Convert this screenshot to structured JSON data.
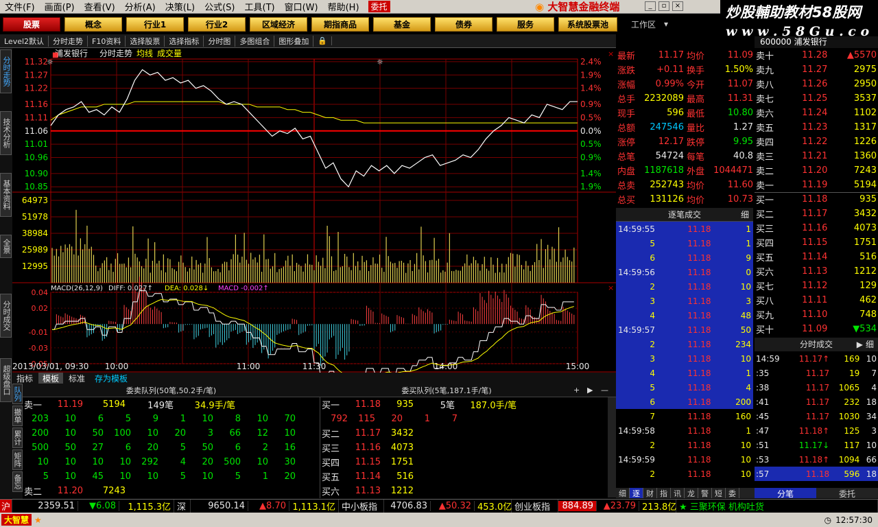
{
  "menu": {
    "items": [
      "文件(F)",
      "画面(P)",
      "查看(V)",
      "分析(A)",
      "决策(L)",
      "公式(S)",
      "工具(T)",
      "窗口(W)",
      "帮助(H)"
    ],
    "entrust": "委托",
    "brand": "大智慧金融终端"
  },
  "logo": {
    "line1": "炒股輔助教材58股网",
    "line2": "w w w . 5 8 G u . c o m"
  },
  "categories": [
    "股票",
    "概念",
    "行业1",
    "行业2",
    "区域经济",
    "期指商品",
    "基金",
    "债券",
    "服务",
    "系统股票池"
  ],
  "workarea": "工作区",
  "toolbar": [
    "Level2默认",
    "分时走势",
    "F10资料",
    "选择股票",
    "选择指标",
    "分时图",
    "多图组合",
    "图形叠加"
  ],
  "side_tabs": [
    "分时走势",
    "技术分析",
    "基本资料",
    "全景",
    "分时成交",
    "超级盘口"
  ],
  "chart": {
    "stock_name": "浦发银行",
    "view": "分时走势",
    "avg_label": "均线",
    "vol_label": "成交量",
    "price_ticks": [
      "11.32",
      "11.27",
      "11.22",
      "11.16",
      "11.11",
      "11.06",
      "11.01",
      "10.96",
      "10.90",
      "10.85"
    ],
    "pct_ticks": [
      "2.4%",
      "1.9%",
      "1.4%",
      "0.9%",
      "0.5%",
      "0.0%",
      "0.5%",
      "0.9%",
      "1.4%",
      "1.9%"
    ],
    "vol_ticks": [
      "64973",
      "51978",
      "38984",
      "25989",
      "12995"
    ],
    "macd_label": "MACD(26,12,9)",
    "diff_label": "DIFF: 0.027↑",
    "dea_label": "DEA: 0.028↓",
    "macd_val_label": "MACD -0.002↑",
    "macd_ticks": [
      "0.04",
      "0.02",
      "-0.01",
      "-0.03",
      "-0.05"
    ],
    "time_ticks": [
      "2013/03/01, 09:30",
      "10:00",
      "11:00",
      "11:30",
      "14:00",
      "15:00"
    ]
  },
  "chart_data": {
    "type": "line",
    "title": "",
    "prev_close": 11.06,
    "ylim": [
      10.83,
      11.33
    ],
    "series": [
      {
        "name": "",
        "values": [
          11.08,
          11.12,
          11.14,
          11.15,
          11.17,
          11.13,
          11.14,
          11.12,
          11.15,
          11.13,
          11.18,
          11.25,
          11.29,
          11.27,
          11.28,
          11.25,
          11.26,
          11.24,
          11.25,
          11.22,
          11.23,
          11.21,
          11.18,
          11.16,
          11.17,
          11.16,
          11.13,
          11.1,
          11.07,
          11.04,
          11.06,
          11.05,
          11.07,
          11.03,
          11.04,
          10.98,
          10.92,
          10.94,
          10.88,
          10.85,
          10.91,
          10.89,
          10.93,
          10.91,
          10.93,
          10.9,
          10.93,
          10.92,
          10.94,
          10.96,
          10.97,
          10.93,
          10.94,
          10.95,
          10.97,
          10.96,
          10.99,
          11.03,
          11.06,
          11.08,
          11.11,
          11.1,
          11.09,
          11.12,
          11.11,
          11.16,
          11.15,
          11.14,
          11.17,
          11.17
        ]
      },
      {
        "name": "均线",
        "values": [
          11.1,
          11.12,
          11.13,
          11.14,
          11.15,
          11.15,
          11.15,
          11.16,
          11.16,
          11.16,
          11.16,
          11.17,
          11.17,
          11.17,
          11.17,
          11.17,
          11.17,
          11.17,
          11.17,
          11.17,
          11.17,
          11.17,
          11.17,
          11.16,
          11.16,
          11.16,
          11.16,
          11.15,
          11.15,
          11.15,
          11.15,
          11.14,
          11.14,
          11.13,
          11.13,
          11.12,
          11.11,
          11.11,
          11.1,
          11.1,
          11.1,
          11.09,
          11.09,
          11.09,
          11.09,
          11.09,
          11.09,
          11.09,
          11.09,
          11.09,
          11.09,
          11.09,
          11.09,
          11.09,
          11.09,
          11.09,
          11.09,
          11.09,
          11.09,
          11.09,
          11.09,
          11.09,
          11.09,
          11.09,
          11.09,
          11.09,
          11.09,
          11.09,
          11.09,
          11.09
        ]
      }
    ],
    "volume_max": 64973
  },
  "quote": {
    "rows": [
      {
        "l1": "最新",
        "v1": "11.17",
        "c1": "red",
        "l2": "均价",
        "v2": "11.09",
        "c2": "red"
      },
      {
        "l1": "涨跌",
        "v1": "+0.11",
        "c1": "red",
        "l2": "换手",
        "v2": "1.50%",
        "c2": "yellow"
      },
      {
        "l1": "涨幅",
        "v1": "0.99%",
        "c1": "red",
        "l2": "今开",
        "v2": "11.07",
        "c2": "red"
      },
      {
        "l1": "总手",
        "v1": "2232089",
        "c1": "yellow",
        "l2": "最高",
        "v2": "11.31",
        "c2": "red"
      },
      {
        "l1": "现手",
        "v1": "596",
        "c1": "yellow",
        "l2": "最低",
        "v2": "10.80",
        "c2": "green"
      },
      {
        "l1": "总额",
        "v1": "247546",
        "c1": "cyan",
        "l2": "量比",
        "v2": "1.27",
        "c2": "white"
      },
      {
        "l1": "涨停",
        "v1": "12.17",
        "c1": "red",
        "l2": "跌停",
        "v2": "9.95",
        "c2": "green"
      },
      {
        "l1": "总笔",
        "v1": "54724",
        "c1": "white",
        "l2": "每笔",
        "v2": "40.8",
        "c2": "white"
      },
      {
        "l1": "内盘",
        "v1": "1187618",
        "c1": "green",
        "l2": "外盘",
        "v2": "1044471",
        "c2": "red"
      },
      {
        "l1": "总卖",
        "v1": "252743",
        "c1": "yellow",
        "l2": "均价",
        "v2": "11.60",
        "c2": "red"
      },
      {
        "l1": "总买",
        "v1": "131126",
        "c1": "yellow",
        "l2": "均价",
        "v2": "10.73",
        "c2": "red"
      }
    ]
  },
  "orderbook": {
    "header": "600000 浦发银行",
    "sells": [
      {
        "label": "卖十",
        "price": "11.28",
        "vol": "▲5570"
      },
      {
        "label": "卖九",
        "price": "11.27",
        "vol": "2975"
      },
      {
        "label": "卖八",
        "price": "11.26",
        "vol": "2950"
      },
      {
        "label": "卖七",
        "price": "11.25",
        "vol": "3537"
      },
      {
        "label": "卖六",
        "price": "11.24",
        "vol": "1102"
      },
      {
        "label": "卖五",
        "price": "11.23",
        "vol": "1317"
      },
      {
        "label": "卖四",
        "price": "11.22",
        "vol": "1226"
      },
      {
        "label": "卖三",
        "price": "11.21",
        "vol": "1360"
      },
      {
        "label": "卖二",
        "price": "11.20",
        "vol": "7243"
      },
      {
        "label": "卖一",
        "price": "11.19",
        "vol": "5194"
      }
    ],
    "buys": [
      {
        "label": "买一",
        "price": "11.18",
        "vol": "935"
      },
      {
        "label": "买二",
        "price": "11.17",
        "vol": "3432"
      },
      {
        "label": "买三",
        "price": "11.16",
        "vol": "4073"
      },
      {
        "label": "买四",
        "price": "11.15",
        "vol": "1751"
      },
      {
        "label": "买五",
        "price": "11.14",
        "vol": "516"
      },
      {
        "label": "买六",
        "price": "11.13",
        "vol": "1212"
      },
      {
        "label": "买七",
        "price": "11.12",
        "vol": "129"
      },
      {
        "label": "买八",
        "price": "11.11",
        "vol": "462"
      },
      {
        "label": "买九",
        "price": "11.10",
        "vol": "748"
      },
      {
        "label": "买十",
        "price": "11.09",
        "vol": "▼534"
      }
    ]
  },
  "ticks": {
    "title": "逐笔成交",
    "detail": "细",
    "rows": [
      {
        "t": "14:59:55",
        "p": "11.18",
        "v": "1",
        "b": true
      },
      {
        "t": "5",
        "p": "11.18",
        "v": "1",
        "b": true
      },
      {
        "t": "6",
        "p": "11.18",
        "v": "9",
        "b": true
      },
      {
        "t": "14:59:56",
        "p": "11.18",
        "v": "0",
        "b": true
      },
      {
        "t": "2",
        "p": "11.18",
        "v": "10",
        "b": true
      },
      {
        "t": "3",
        "p": "11.18",
        "v": "3",
        "b": true
      },
      {
        "t": "4",
        "p": "11.18",
        "v": "48",
        "b": true
      },
      {
        "t": "14:59:57",
        "p": "11.18",
        "v": "50",
        "b": true
      },
      {
        "t": "2",
        "p": "11.18",
        "v": "234",
        "b": true
      },
      {
        "t": "3",
        "p": "11.18",
        "v": "10",
        "b": true
      },
      {
        "t": "4",
        "p": "11.18",
        "v": "1",
        "b": true
      },
      {
        "t": "5",
        "p": "11.18",
        "v": "4",
        "b": true
      },
      {
        "t": "6",
        "p": "11.18",
        "v": "200",
        "b": true
      },
      {
        "t": "7",
        "p": "11.18",
        "v": "160",
        "b": false
      },
      {
        "t": "14:59:58",
        "p": "11.18",
        "v": "1",
        "b": false
      },
      {
        "t": "2",
        "p": "11.18",
        "v": "10",
        "b": false
      },
      {
        "t": "14:59:59",
        "p": "11.18",
        "v": "10",
        "b": false
      },
      {
        "t": "2",
        "p": "11.18",
        "v": "10",
        "b": false
      }
    ]
  },
  "fenbi": {
    "title": "分时成交",
    "rows": [
      {
        "t": "14:59",
        "p": "11.17↑",
        "v": "169",
        "n": "10"
      },
      {
        "t": ":35",
        "p": "11.17",
        "v": "19",
        "n": "7"
      },
      {
        "t": ":38",
        "p": "11.17",
        "v": "1065",
        "n": "4"
      },
      {
        "t": ":41",
        "p": "11.17",
        "v": "232",
        "n": "18"
      },
      {
        "t": ":45",
        "p": "11.17",
        "v": "1030",
        "n": "34"
      },
      {
        "t": ":47",
        "p": "11.18↑",
        "v": "125",
        "n": "3"
      },
      {
        "t": ":51",
        "p": "11.17↓",
        "v": "117",
        "n": "10"
      },
      {
        "t": ":53",
        "p": "11.18↑",
        "v": "1094",
        "n": "66"
      },
      {
        "t": ":57",
        "p": "11.18",
        "v": "596",
        "n": "18"
      }
    ],
    "tab_a": "分笔",
    "tab_b": "委托"
  },
  "bottom_tabs": [
    "细",
    "逐",
    "财",
    "指",
    "讯",
    "龙",
    "警",
    "短",
    "委"
  ],
  "queue": {
    "tabs": [
      "指标",
      "模板",
      "标准",
      "存为模板"
    ],
    "left_tabs": [
      "队列",
      "撤单",
      "累计",
      "矩阵",
      "备忘"
    ],
    "sell_title": "委卖队列(50笔,50.2手/笔)",
    "buy_title": "委买队列(5笔,187.1手/笔)",
    "sell1": {
      "label": "卖一",
      "price": "11.19",
      "vol": "5194",
      "cnt": "149笔",
      "avg": "34.9手/笔"
    },
    "sell_rows": [
      [
        "203",
        "10",
        "6",
        "5",
        "9",
        "1",
        "10",
        "8",
        "10",
        "70"
      ],
      [
        "200",
        "10",
        "50",
        "100",
        "10",
        "20",
        "3",
        "66",
        "12",
        "10"
      ],
      [
        "500",
        "50",
        "27",
        "6",
        "20",
        "5",
        "50",
        "6",
        "2",
        "16"
      ],
      [
        "10",
        "10",
        "10",
        "10",
        "292",
        "4",
        "20",
        "500",
        "10",
        "30"
      ],
      [
        "5",
        "10",
        "45",
        "10",
        "10",
        "5",
        "10",
        "5",
        "1",
        "20"
      ]
    ],
    "sell2": {
      "label": "卖二",
      "price": "11.20",
      "vol": "7243"
    },
    "buy1": {
      "label": "买一",
      "price": "11.18",
      "vol": "935",
      "cnt": "5笔",
      "avg": "187.0手/笔"
    },
    "buy_queue": [
      "792",
      "115",
      "20",
      "1",
      "7"
    ],
    "buy_rows": [
      {
        "label": "买二",
        "price": "11.17",
        "vol": "3432"
      },
      {
        "label": "买三",
        "price": "11.16",
        "vol": "4073"
      },
      {
        "label": "买四",
        "price": "11.15",
        "vol": "1751"
      },
      {
        "label": "买五",
        "price": "11.14",
        "vol": "516"
      },
      {
        "label": "买六",
        "price": "11.13",
        "vol": "1212"
      }
    ]
  },
  "status": {
    "sh_label": "沪",
    "sh": "2359.51",
    "sh_chg": "▼6.08",
    "sh_amt": "1,115.3亿",
    "sz_label": "深",
    "sz": "9650.14",
    "sz_chg": "▲8.70",
    "sz_amt": "1,113.1亿",
    "zx_label": "中小板指",
    "zx": "4706.83",
    "zx_chg": "▲50.32",
    "zx_amt": "453.0亿",
    "cy_label": "创业板指",
    "cy": "884.89",
    "cy_chg": "▲23.79",
    "cy_amt": "213.8亿",
    "news": "★ 三聚环保 机构吐货"
  },
  "bottombar": {
    "app": "大智慧",
    "clock": "12:57:30"
  }
}
